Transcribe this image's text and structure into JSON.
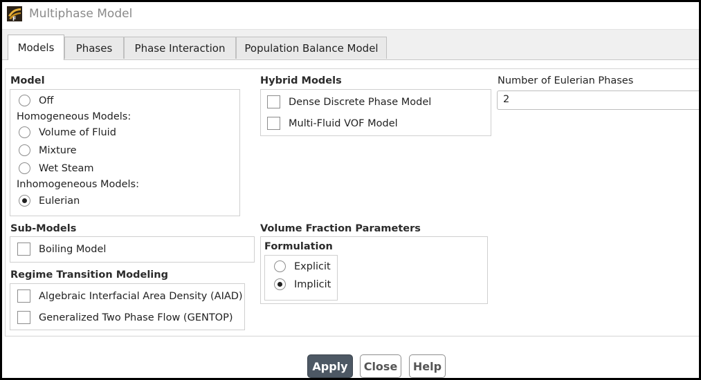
{
  "window": {
    "title": "Multiphase Model"
  },
  "tabs": [
    "Models",
    "Phases",
    "Phase Interaction",
    "Population Balance Model"
  ],
  "model": {
    "heading": "Model",
    "off": "Off",
    "homogeneous_label": "Homogeneous Models:",
    "homogeneous": [
      "Volume of Fluid",
      "Mixture",
      "Wet Steam"
    ],
    "inhomogeneous_label": "Inhomogeneous Models:",
    "inhomogeneous": [
      "Eulerian"
    ],
    "selected": "Eulerian"
  },
  "hybrid": {
    "heading": "Hybrid Models",
    "options": [
      "Dense Discrete Phase Model",
      "Multi-Fluid VOF Model"
    ]
  },
  "phases": {
    "label": "Number of Eulerian Phases",
    "value": "2"
  },
  "sub_models": {
    "heading": "Sub-Models",
    "options": [
      "Boiling Model"
    ]
  },
  "regime": {
    "heading": "Regime Transition Modeling",
    "options": [
      "Algebraic Interfacial Area Density (AIAD)",
      "Generalized Two Phase Flow (GENTOP)"
    ]
  },
  "volume_fraction": {
    "heading": "Volume Fraction Parameters",
    "formulation_label": "Formulation",
    "options": [
      "Explicit",
      "Implicit"
    ],
    "selected": "Implicit"
  },
  "buttons": {
    "apply": "Apply",
    "close": "Close",
    "help": "Help"
  },
  "colors": {
    "apply_bg": "#4d5864",
    "border": "#cfcfcf"
  }
}
